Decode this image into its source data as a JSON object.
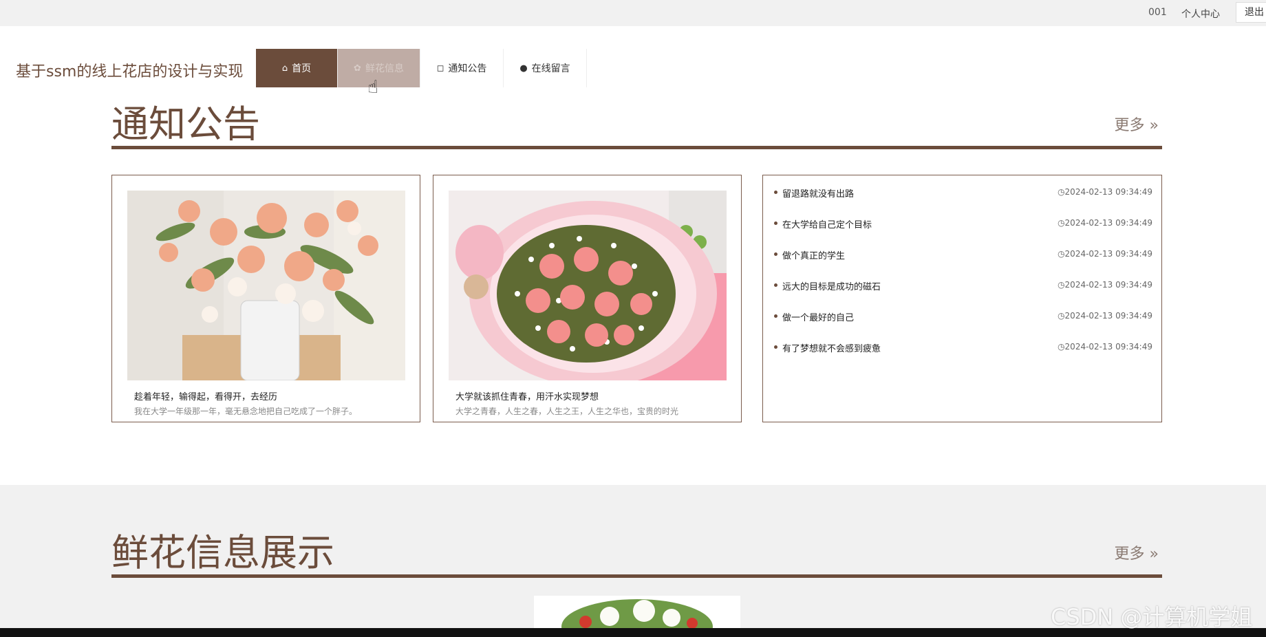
{
  "topbar": {
    "user": "001",
    "center": "个人中心",
    "logout": "退出"
  },
  "header": {
    "title": "基于ssm的线上花店的设计与实现",
    "nav": [
      {
        "label": "首页",
        "icon": "home-icon",
        "state": "active"
      },
      {
        "label": "鲜花信息",
        "icon": "flower-icon",
        "state": "hover"
      },
      {
        "label": "通知公告",
        "icon": "bag-icon",
        "state": "normal"
      },
      {
        "label": "在线留言",
        "icon": "alert-icon",
        "state": "normal"
      }
    ]
  },
  "notice_section": {
    "heading": "通知公告",
    "more": "更多",
    "cards": [
      {
        "title": "趁着年轻，输得起，看得开，去经历",
        "desc": "我在大学一年级那一年，毫无悬念地把自己吃成了一个胖子。"
      },
      {
        "title": "大学就该抓住青春，用汗水实现梦想",
        "desc": "大学之青春，人生之春，人生之王，人生之华也，宝贵的时光"
      }
    ],
    "list": [
      {
        "title": "留退路就没有出路",
        "time": "2024-02-13 09:34:49"
      },
      {
        "title": "在大学给自己定个目标",
        "time": "2024-02-13 09:34:49"
      },
      {
        "title": "做个真正的学生",
        "time": "2024-02-13 09:34:49"
      },
      {
        "title": "远大的目标是成功的磁石",
        "time": "2024-02-13 09:34:49"
      },
      {
        "title": "做一个最好的自己",
        "time": "2024-02-13 09:34:49"
      },
      {
        "title": "有了梦想就不会感到疲惫",
        "time": "2024-02-13 09:34:49"
      }
    ]
  },
  "flower_section": {
    "heading": "鲜花信息展示",
    "more": "更多"
  },
  "watermark": "CSDN @计算机学姐",
  "colors": {
    "brand": "#6b4c3b",
    "nav_hover": "#bfaca5",
    "band": "#f1f1f1"
  }
}
